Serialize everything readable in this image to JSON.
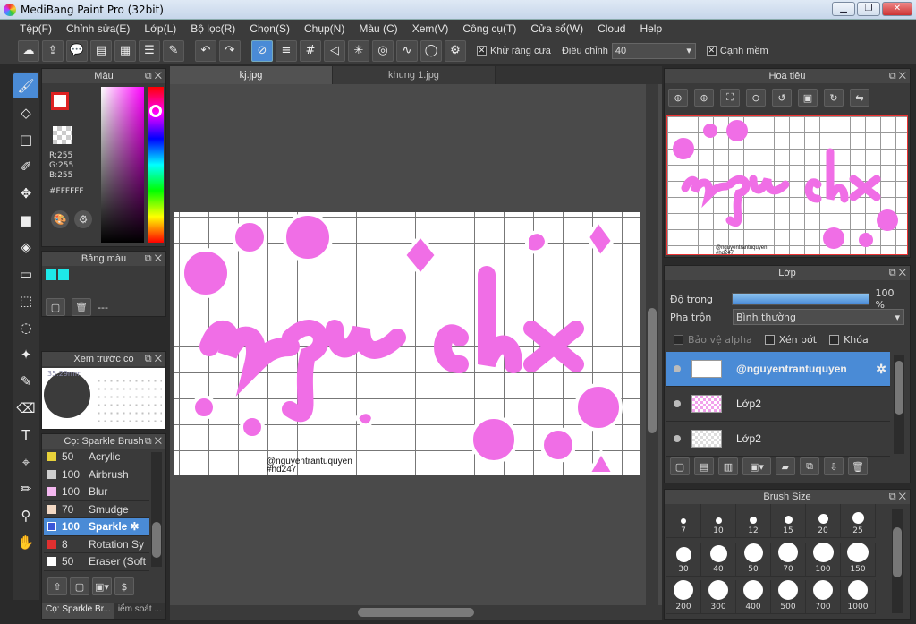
{
  "window": {
    "title": "MediBang Paint Pro (32bit)"
  },
  "menu": [
    "Tệp(F)",
    "Chỉnh sửa(E)",
    "Lớp(L)",
    "Bộ lọc(R)",
    "Chọn(S)",
    "Chụp(N)",
    "Màu (C)",
    "Xem(V)",
    "Công cụ(T)",
    "Cửa sổ(W)",
    "Cloud",
    "Help"
  ],
  "toolbar": {
    "antialias_label": "Khử răng cưa",
    "adjust_label": "Điều chỉnh",
    "adjust_value": "40",
    "edge_label": "Cạnh mềm"
  },
  "color_panel": {
    "title": "Màu",
    "r": "R:255",
    "g": "G:255",
    "b": "B:255",
    "hex": "#FFFFFF"
  },
  "palette_panel": {
    "title": "Bảng màu",
    "dash": "---"
  },
  "brush_preview": {
    "title": "Xem trước cọ",
    "size": "35.29mm"
  },
  "brush_panel": {
    "title": "Cọ: Sparkle Brush",
    "items": [
      {
        "size": "50",
        "name": "Acrylic",
        "color": "#e8d23a"
      },
      {
        "size": "100",
        "name": "Airbrush",
        "color": "#cfcfcf"
      },
      {
        "size": "100",
        "name": "Blur",
        "color": "#f4b8f0"
      },
      {
        "size": "70",
        "name": "Smudge",
        "color": "#f3d9c4"
      },
      {
        "size": "100",
        "name": "Sparkle",
        "color": "#3a57d8"
      },
      {
        "size": "8",
        "name": "Rotation Sy",
        "color": "#e03030"
      },
      {
        "size": "50",
        "name": "Eraser (Soft",
        "color": "#ffffff"
      }
    ],
    "bottom_tab1": "Cọ: Sparkle Br...",
    "bottom_tab2": "iểm soát ..."
  },
  "tabs": [
    "kj.jpg",
    "khung 1.jpg"
  ],
  "canvas": {
    "watermark1": "@nguyentrantuquyen",
    "watermark2": "#hd247"
  },
  "navigator": {
    "title": "Hoa tiêu"
  },
  "layer_panel": {
    "title": "Lớp",
    "opacity_label": "Độ trong",
    "opacity_value": "100 %",
    "opacity": 1.0,
    "blend_label": "Pha trộn",
    "blend_value": "Bình thường",
    "protect_alpha": "Bảo vệ alpha",
    "clip": "Xén bớt",
    "lock": "Khóa",
    "layers": [
      {
        "name": "@nguyentrantuquyen"
      },
      {
        "name": "Lớp2"
      },
      {
        "name": "Lớp2"
      }
    ]
  },
  "brush_size": {
    "title": "Brush Size",
    "sizes": [
      "7",
      "10",
      "12",
      "15",
      "20",
      "25",
      "30",
      "40",
      "50",
      "70",
      "100",
      "150",
      "200",
      "300",
      "400",
      "500",
      "700",
      "1000"
    ]
  }
}
